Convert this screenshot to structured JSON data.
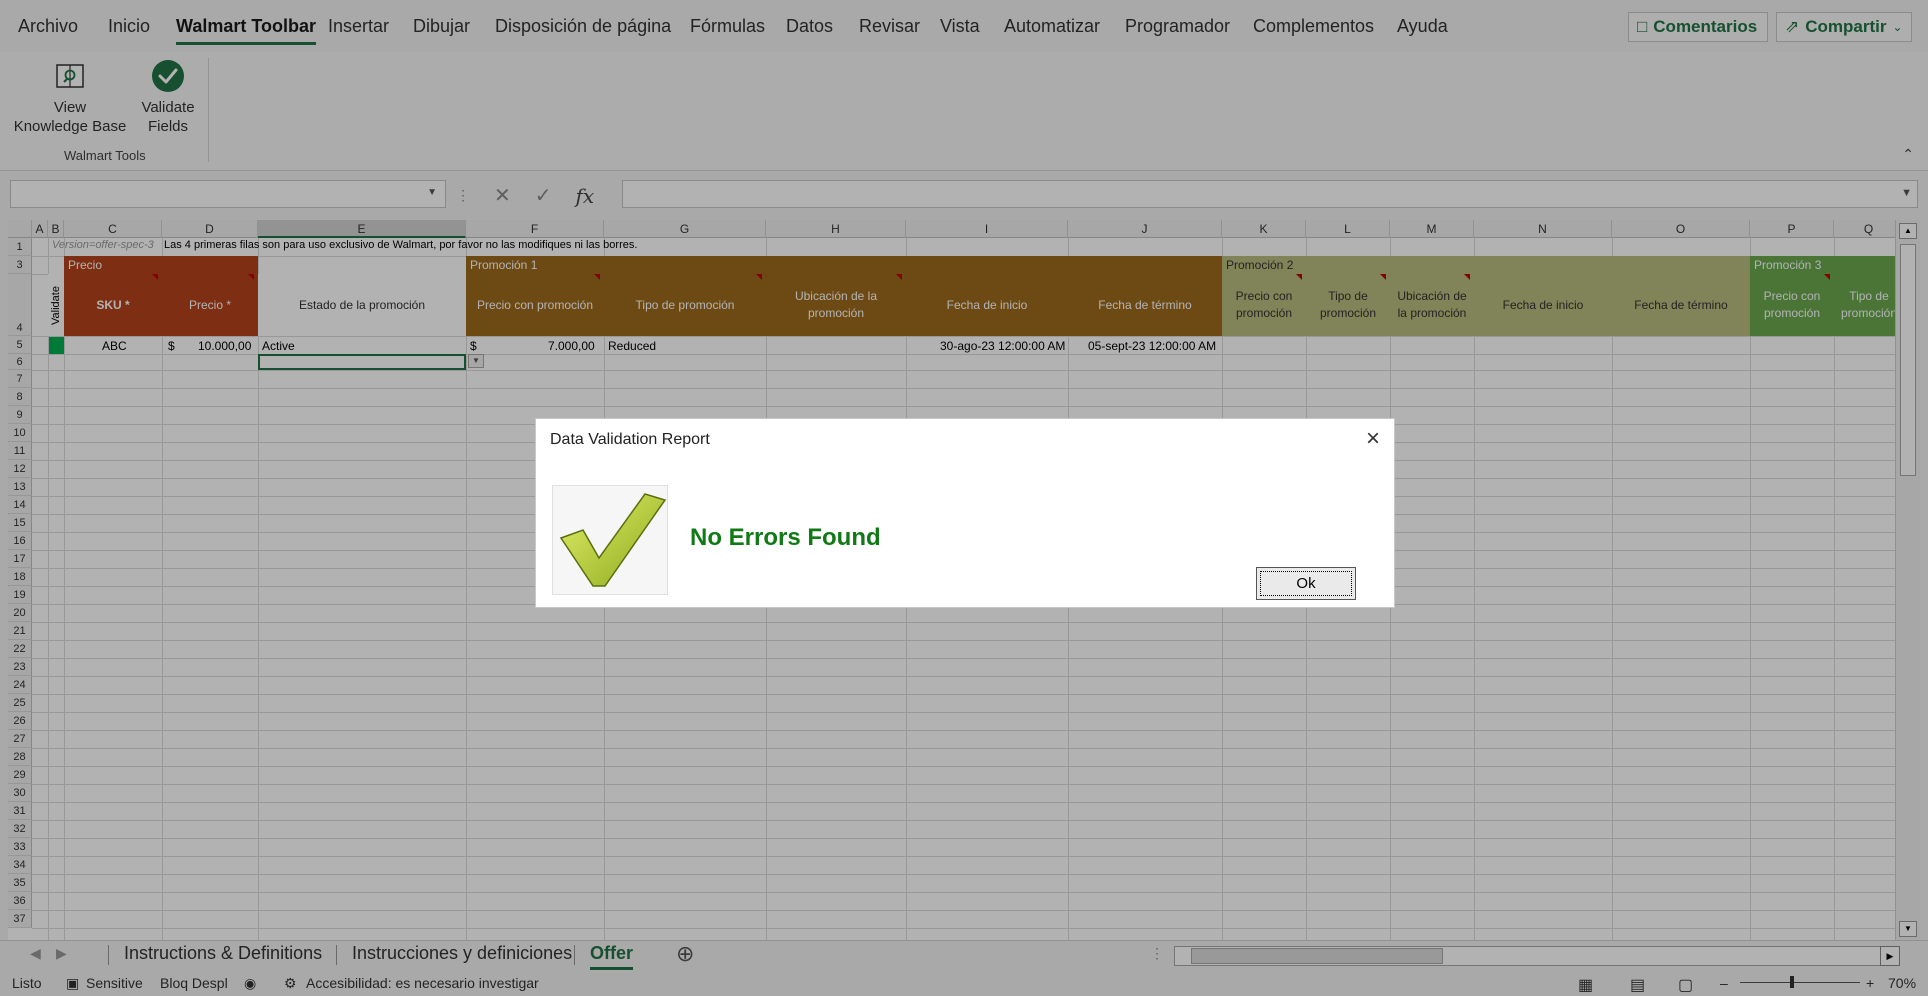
{
  "ribbon": {
    "tabs": [
      "Archivo",
      "Inicio",
      "Walmart Toolbar",
      "Insertar",
      "Dibujar",
      "Disposición de página",
      "Fórmulas",
      "Datos",
      "Revisar",
      "Vista",
      "Automatizar",
      "Programador",
      "Complementos",
      "Ayuda"
    ],
    "active_tab": "Walmart Toolbar",
    "comments_label": "Comentarios",
    "share_label": "Compartir",
    "buttons": [
      {
        "line1": "View",
        "line2": "Knowledge Base",
        "icon": "book-search-icon"
      },
      {
        "line1": "Validate",
        "line2": "Fields",
        "icon": "check-circle-icon"
      }
    ],
    "group_label": "Walmart Tools"
  },
  "formula_bar": {
    "fx_label": "fx",
    "cancel_icon": "✕",
    "enter_icon": "✓"
  },
  "sheet": {
    "columns": [
      "A",
      "B",
      "C",
      "D",
      "E",
      "F",
      "G",
      "H",
      "I",
      "J",
      "K",
      "L",
      "M",
      "N",
      "O",
      "P",
      "Q"
    ],
    "selected_column": "E",
    "rows": [
      "1",
      "2",
      "3",
      "4",
      "5",
      "6",
      "7",
      "8",
      "9",
      "10",
      "11",
      "12",
      "13",
      "14",
      "15",
      "16",
      "17",
      "18",
      "19",
      "20",
      "21",
      "22",
      "23",
      "24",
      "25",
      "26",
      "27",
      "28",
      "29",
      "30",
      "31",
      "32",
      "33",
      "34",
      "35",
      "36",
      "37"
    ],
    "row1_version": "Version=offer-spec-3",
    "row1_note": "Las 4 primeras filas son para uso exclusivo de Walmart, por favor no las modifiques ni las borres.",
    "section_precio": "Precio",
    "section_promo1": "Promoción 1",
    "section_promo2": "Promoción 2",
    "section_promo3": "Promoción 3",
    "validate_label": "Validate",
    "headers": {
      "sku": "SKU *",
      "precio": "Precio *",
      "estado": "Estado de la promoción",
      "p1_precio": "Precio con promoción",
      "p1_tipo": "Tipo de promoción",
      "p1_ubic": "Ubicación de la promoción",
      "p1_inicio": "Fecha de inicio",
      "p1_termino": "Fecha de término",
      "p2_precio": "Precio con promoción",
      "p2_tipo": "Tipo de promoción",
      "p2_ubic": "Ubicación de la promoción",
      "p2_inicio": "Fecha de inicio",
      "p2_termino": "Fecha de término",
      "p3_precio": "Precio con promoción",
      "p3_tipo": "Tipo de promoción"
    },
    "data_row": {
      "sku": "ABC",
      "precio_symbol": "$",
      "precio": "10.000,00",
      "estado": "Active",
      "p1_symbol": "$",
      "p1_precio": "7.000,00",
      "p1_tipo": "Reduced",
      "p1_inicio": "30-ago-23 12:00:00 AM",
      "p1_termino": "05-sept-23 12:00:00 AM"
    },
    "colors": {
      "precio_header": "#b5421a",
      "promo1_header": "#9c6a1e",
      "promo2_header": "#b9bc7e",
      "promo3_header": "#6aa84f",
      "validate_cell": "#00b050",
      "accent": "#217346"
    }
  },
  "sheet_tabs": [
    "Instructions & Definitions",
    "Instrucciones y definiciones",
    "Offer"
  ],
  "active_sheet": "Offer",
  "status": {
    "ready": "Listo",
    "sensitivity": "Sensitive",
    "scroll_lock": "Bloq Despl",
    "accessibility": "Accesibilidad: es necesario investigar",
    "zoom": "70%"
  },
  "dialog": {
    "title": "Data Validation Report",
    "message": "No Errors Found",
    "ok_label": "Ok",
    "close_icon": "×"
  }
}
